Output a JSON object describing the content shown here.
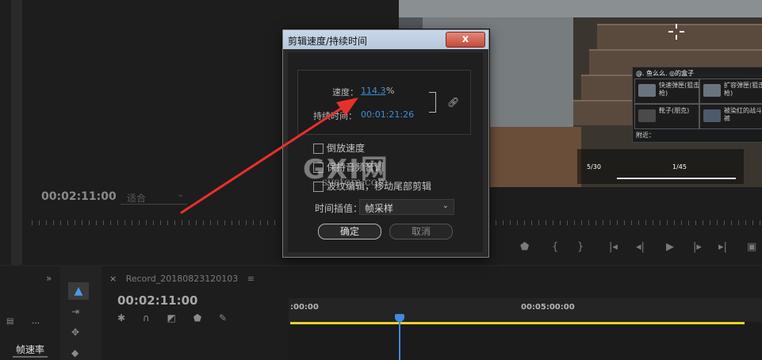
{
  "program_monitor": {
    "timecode": "00:02:11:00",
    "fit_select": "适合"
  },
  "timeline": {
    "sequence_tab": "Record_20180823120103",
    "timecode": "00:02:11:00",
    "ruler_labels": [
      ":00:00",
      "00:05:00:00"
    ],
    "track_color": "#e6d22a",
    "playhead_color": "#3f8ae2"
  },
  "left_panel": {
    "frame_rate_tab": "帧速率"
  },
  "dialog": {
    "title": "剪辑速度/持续时间",
    "close_symbol": "x",
    "speed_label": "速度：",
    "speed_value": "114.3",
    "speed_unit": "%",
    "duration_label": "持续时间：",
    "duration_value": "00:01:21:26",
    "checkboxes": [
      {
        "label": "倒放速度",
        "checked": false
      },
      {
        "label": "保持音频音调",
        "checked": false
      },
      {
        "label": "波纹编辑，移动尾部剪辑",
        "checked": false
      }
    ],
    "interp_label": "时间插值：",
    "interp_value": "帧采样",
    "ok_label": "确定",
    "cancel_label": "取消"
  },
  "watermark": {
    "logo_text": "GXI网",
    "sub_text": "system.com"
  },
  "game_hud": {
    "header": "@. 鱼么么.  ◎的盒子",
    "items": [
      "快速弹匣(狙击枪)",
      "扩容弹匣(狙击枪)",
      "靴子(朋克)",
      "被染红的战斗裤"
    ],
    "ammo": "5/30",
    "ammo2": "1/45",
    "nearby": "附近："
  }
}
